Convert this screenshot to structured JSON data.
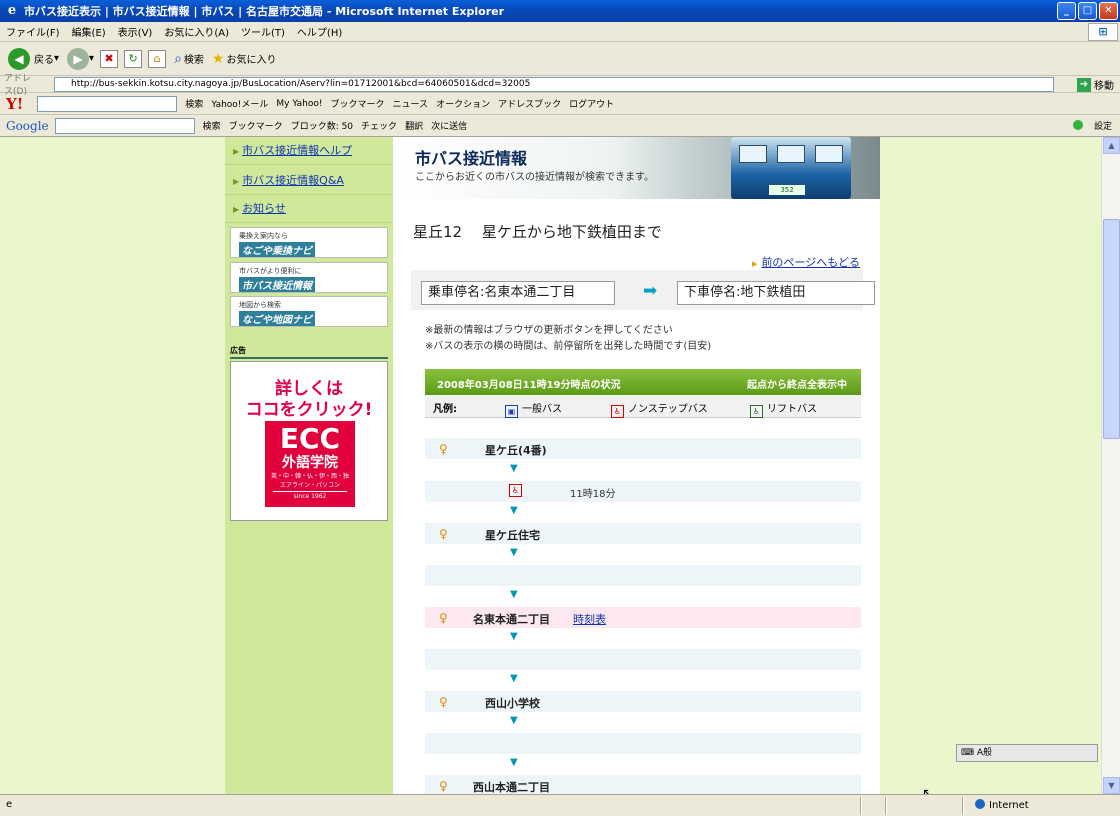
{
  "window": {
    "title": "市バス接近表示 | 市バス接近情報 | 市バス | 名古屋市交通局 - Microsoft Internet Explorer"
  },
  "menu": [
    "ファイル(F)",
    "編集(E)",
    "表示(V)",
    "お気に入り(A)",
    "ツール(T)",
    "ヘルプ(H)"
  ],
  "nav": {
    "back": "戻る",
    "search": "検索",
    "favorites": "お気に入り"
  },
  "address": {
    "label": "アドレス(D)",
    "url": "http://bus-sekkin.kotsu.city.nagoya.jp/BusLocation/Aserv?lin=01712001&bcd=64060501&dcd=32005",
    "go": "移動"
  },
  "yahoo_toolbar": [
    "検索",
    "Yahoo!メール",
    "My Yahoo!",
    "ブックマーク",
    "ニュース",
    "オークション",
    "アドレスブック",
    "ログアウト"
  ],
  "google_toolbar": [
    "検索",
    "ブックマーク",
    "ブロック数: 50",
    "チェック",
    "翻訳",
    "次に送信",
    "設定"
  ],
  "sidebar": {
    "links": [
      "市バス接近情報ヘルプ",
      "市バス接近情報Q&A",
      "お知らせ"
    ],
    "banners": [
      {
        "small": "乗換え案内なら",
        "big": "なごや乗換ナビ"
      },
      {
        "small": "市バスがより便利に",
        "big": "市バス接近情報"
      },
      {
        "small": "地図から検索",
        "big": "なごや地図ナビ"
      }
    ],
    "ad_label": "広告",
    "ad": {
      "line1": "詳しくは",
      "line2": "ココをクリック!",
      "logo": "ECC",
      "logo_sub": "外語学院",
      "langs": "英・中・韓・仏・伊・西・独",
      "online": "エアライン・パソコン",
      "since": "since 1962"
    }
  },
  "page": {
    "header_title": "市バス接近情報",
    "header_sub": "ここからお近くの市バスの接近情報が検索できます。",
    "bus_plate": "352",
    "route": "星丘12　 星ケ丘から地下鉄植田まで",
    "back_link": "前のページへもどる",
    "board_stop": "乗車停名:名東本通二丁目",
    "alight_stop": "下車停名:地下鉄植田",
    "note1": "※最新の情報はブラウザの更新ボタンを押してください",
    "note2": "※バスの表示の横の時間は、前停留所を出発した時間です(目安)",
    "status": "2008年03月08日11時19分時点の状況",
    "status_right": "起点から終点全表示中",
    "legend_label": "凡例:",
    "legend": [
      "一般バス",
      "ノンステップバス",
      "リフトバス"
    ],
    "stops": [
      "星ケ丘(4番)",
      "星ケ丘住宅",
      "名東本通二丁目",
      "西山小学校",
      "西山本通二丁目"
    ],
    "timetable": "時刻表",
    "bus_time": "11時18分"
  },
  "statusbar": {
    "zone": "Internet"
  },
  "ime": "A般"
}
